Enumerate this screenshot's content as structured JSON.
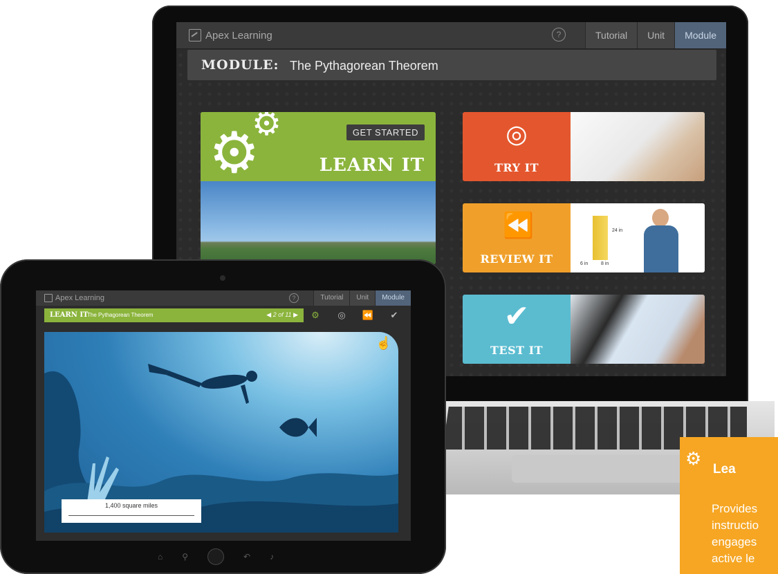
{
  "laptop": {
    "brand": "Apex Learning",
    "help_icon": "?",
    "tabs": [
      "Tutorial",
      "Unit",
      "Module"
    ],
    "active_tab": "Module",
    "module_label": "MODULE:",
    "module_title": "The Pythagorean Theorem",
    "learn": {
      "button": "GET STARTED",
      "title": "LEARN IT"
    },
    "try": {
      "title": "TRY IT"
    },
    "review": {
      "title": "REVIEW IT",
      "dims": [
        "24 in",
        "6 in",
        "8 in"
      ]
    },
    "test": {
      "title": "TEST IT"
    }
  },
  "tablet": {
    "brand": "Apex Learning",
    "help_icon": "?",
    "tabs": [
      "Tutorial",
      "Unit",
      "Module"
    ],
    "active_tab": "Module",
    "bar_label": "LEARN IT",
    "bar_title": "The Pythagorean Theorem",
    "pager": "2 of 11",
    "scale_label": "1,400 square miles"
  },
  "info_panel": {
    "title": "Lea",
    "lines": [
      "Provides",
      "instructio",
      "engages",
      "active le"
    ]
  },
  "colors": {
    "green": "#8bb43c",
    "orange": "#e4572e",
    "amber": "#f0a02a",
    "teal": "#5bbcd0",
    "panel": "#f6a623"
  }
}
